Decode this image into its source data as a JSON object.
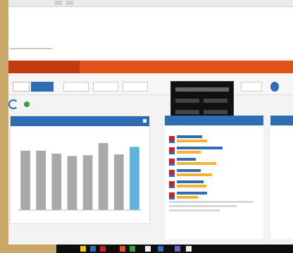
{
  "browser": {
    "address": ""
  },
  "site": {
    "name": ""
  },
  "nav": {
    "items": [
      {
        "label": "",
        "active": true
      },
      {
        "label": "",
        "active": false
      },
      {
        "label": "",
        "active": false
      },
      {
        "label": "",
        "active": false
      }
    ]
  },
  "toolbar": {
    "buttons": [
      "",
      ""
    ]
  },
  "page": {
    "heading": ""
  },
  "colors": {
    "accent": "#e0521a",
    "primary": "#2f6db3",
    "bar_gray": "#a9a9a9",
    "bar_highlight": "#5fb4dd",
    "progress": "#f3b334"
  },
  "chart_data": {
    "type": "bar",
    "categories": [
      "",
      "",
      "",
      "",
      "",
      "",
      "",
      ""
    ],
    "values": [
      78,
      78,
      74,
      71,
      72,
      88,
      73,
      83
    ],
    "highlight_index": 7,
    "ylim": [
      0,
      100
    ],
    "grid": false
  },
  "rankings": {
    "rows": [
      {
        "name_level": 0.4,
        "value": 0.48
      },
      {
        "name_level": 0.72,
        "value": 0.38
      },
      {
        "name_level": 0.3,
        "value": 0.62
      },
      {
        "name_level": 0.38,
        "value": 0.55
      },
      {
        "name_level": 0.42,
        "value": 0.47
      },
      {
        "name_level": 0.48,
        "value": 0.33
      }
    ]
  }
}
